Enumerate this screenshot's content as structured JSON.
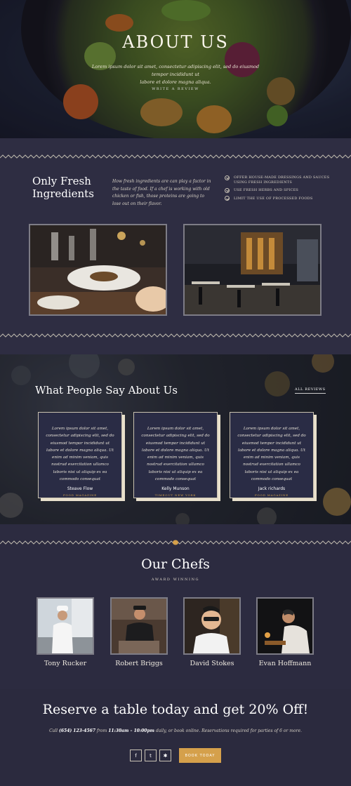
{
  "hero": {
    "title": "ABOUT US",
    "text_line1": "Lorem ipsum dolor sit amet, consectetur adipiscing elit, sed do eiusmod tempor incididunt ut",
    "text_line2": "labore et dolore magna aliqua.",
    "link": "WRITE A REVIEW"
  },
  "fresh": {
    "title_line1": "Only Fresh",
    "title_line2": "Ingredients",
    "text": "How fresh ingredients are can play a factor in the taste of food. If a chef is working with old chicken or fish, those proteins are going to lose out on their flavor.",
    "list": [
      "OFFER HOUSE-MADE DRESSINGS AND SAUCES USING FRESH INGREDIENTS",
      "USE FRESH HERBS AND SPICES",
      "LIMIT THE USE OF PROCESSED FOODS"
    ]
  },
  "reviews": {
    "title": "What People Say About Us",
    "link": "ALL REVIEWS",
    "cards": [
      {
        "text": "Lorem ipsum dolor sit amet, consectetur adipiscing elit, sed do eiusmod tempor incididunt ut labore et dolore magna aliqua. Ut enim ad minim veniam, quis nostrud exercitation ullamco laboris nisi ut aliquip ex ea commodo consequat",
        "name": "Steave Flow",
        "org": "FOOD MAGAZINE"
      },
      {
        "text": "Lorem ipsum dolor sit amet, consectetur adipiscing elit, sed do eiusmod tempor incididunt ut labore et dolore magna aliqua. Ut enim ad minim veniam, quis nostrud exercitation ullamco laboris nisi ut aliquip ex ea commodo consequat",
        "name": "Kelly Munson",
        "org": "TIMEOUT NEW YORK"
      },
      {
        "text": "Lorem ipsum dolor sit amet, consectetur adipiscing elit, sed do eiusmod tempor incididunt ut labore et dolore magna aliqua. Ut enim ad minim veniam, quis nostrud exercitation ullamco laboris nisi ut aliquip ex ea commodo consequat",
        "name": "Jack richards",
        "org": "FOOD MAGAZINE"
      }
    ]
  },
  "chefs": {
    "title": "Our Chefs",
    "subtitle": "AWARD WINNING",
    "people": [
      {
        "name": "Tony Rucker"
      },
      {
        "name": "Robert Briggs"
      },
      {
        "name": "David Stokes"
      },
      {
        "name": "Evan Hoffmann"
      }
    ]
  },
  "reserve": {
    "title": "Reserve a table today and get 20% Off!",
    "text_prefix": "Call ",
    "phone": "(654) 123-4567",
    "text_mid": " from ",
    "hours": "11:30am – 10:00pm",
    "text_suffix": " daily, or book online. Reservations required for parties of 6 or more.",
    "social": [
      {
        "icon": "facebook-icon",
        "glyph": "f"
      },
      {
        "icon": "twitter-icon",
        "glyph": "t"
      },
      {
        "icon": "yelp-icon",
        "glyph": "✱"
      }
    ],
    "button": "BOOK TODAY"
  },
  "colors": {
    "background": "#2b2a3d",
    "accent": "#d5a04b",
    "card": "#2a2c45"
  }
}
